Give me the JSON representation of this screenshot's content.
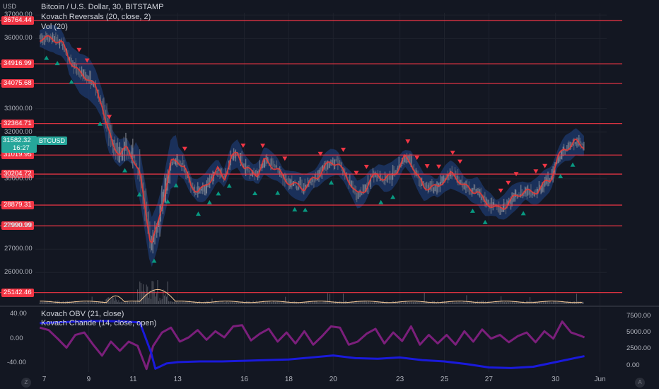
{
  "legend": {
    "symbol": "Bitcoin / U.S. Dollar, 30, BITSTAMP",
    "ind1": "Kovach Reversals (20, close, 2)",
    "ind2": "Vol (20)",
    "ind3": "Kovach OBV (21, close)",
    "ind4": "Kovach Chande (14, close, open)"
  },
  "axis_currency": "USD",
  "last_price": {
    "value": "31582.32",
    "countdown": "16:27",
    "symbol": "BTCUSD"
  },
  "corner_left": "Z",
  "corner_right": "A",
  "colors": {
    "background": "#131722",
    "level_line": "#f23645",
    "badge": "#f23645",
    "price_badge": "#26a69a",
    "trend_line": "#e53935",
    "band": "#1e3a6e",
    "arrow_up": "#089981",
    "arrow_down": "#f23645",
    "volume": "#8a8d96",
    "volume_ma": "#f5c896",
    "obv": "#1a1adb",
    "chande": "#7b1f7b",
    "grid": "#1e222d"
  },
  "chart_data": [
    {
      "type": "line",
      "name": "price",
      "ylim": [
        24800,
        37100
      ],
      "y_ticks": [
        {
          "value": 37000,
          "label": "37000.00"
        },
        {
          "value": 36000,
          "label": "36000.00"
        },
        {
          "value": 33000,
          "label": "33000.00"
        },
        {
          "value": 32000,
          "label": "32000.00"
        },
        {
          "value": 30000,
          "label": "30000.00"
        },
        {
          "value": 28000,
          "label": "28000.00"
        },
        {
          "value": 27000,
          "label": "27000.00"
        },
        {
          "value": 26000,
          "label": "26000.00"
        }
      ],
      "x_ticks": [
        {
          "x": 7,
          "label": "7"
        },
        {
          "x": 9,
          "label": "9"
        },
        {
          "x": 11,
          "label": "11"
        },
        {
          "x": 13,
          "label": "13"
        },
        {
          "x": 16,
          "label": "16"
        },
        {
          "x": 18,
          "label": "18"
        },
        {
          "x": 20,
          "label": "20"
        },
        {
          "x": 23,
          "label": "23"
        },
        {
          "x": 25,
          "label": "25"
        },
        {
          "x": 27,
          "label": "27"
        },
        {
          "x": 30,
          "label": "30"
        },
        {
          "x": 32,
          "label": "Jun"
        }
      ],
      "levels": [
        {
          "value": 36764.44,
          "label": "36764.44"
        },
        {
          "value": 34916.99,
          "label": "34916.99"
        },
        {
          "value": 34075.68,
          "label": "34075.68"
        },
        {
          "value": 32364.71,
          "label": "32364.71"
        },
        {
          "value": 31019.95,
          "label": "31019.95"
        },
        {
          "value": 30204.72,
          "label": "30204.72"
        },
        {
          "value": 28879.31,
          "label": "28879.31"
        },
        {
          "value": 27990.99,
          "label": "27990.99"
        },
        {
          "value": 25142.46,
          "label": "25142.46"
        }
      ],
      "series": [
        {
          "x": [
            6.8,
            7.4,
            7.8,
            8.2,
            8.6,
            9.0,
            9.3,
            9.6,
            9.8,
            10.1,
            10.4,
            10.7,
            11.0,
            11.3,
            11.6,
            11.8,
            12.1,
            12.4,
            12.7,
            13.0,
            13.3,
            13.6,
            13.9,
            14.2,
            14.5,
            14.8,
            15.1,
            15.4,
            15.7,
            16.0,
            16.3,
            16.6,
            16.9,
            17.2,
            17.5,
            17.8,
            18.1,
            18.4,
            18.7,
            19.0,
            19.3,
            19.6,
            19.9,
            20.2,
            20.5,
            20.8,
            21.1,
            21.4,
            21.7,
            22.0,
            22.3,
            22.6,
            22.9,
            23.2,
            23.5,
            23.8,
            24.1,
            24.4,
            24.7,
            25.0,
            25.3,
            25.6,
            25.9,
            26.2,
            26.5,
            26.8,
            27.1,
            27.4,
            27.7,
            28.0,
            28.3,
            28.6,
            28.9,
            29.2,
            29.5,
            29.8,
            30.1,
            30.4,
            30.7,
            30.9,
            31.1,
            31.3
          ],
          "values": [
            36000,
            36000,
            35800,
            35000,
            34500,
            34300,
            33900,
            33200,
            32300,
            31400,
            31100,
            31300,
            30900,
            30200,
            28400,
            27200,
            28000,
            29300,
            30700,
            30800,
            30500,
            29700,
            29500,
            29600,
            30000,
            30400,
            30000,
            30900,
            31100,
            30500,
            30300,
            30200,
            30800,
            30600,
            30400,
            30000,
            29800,
            29700,
            29600,
            29900,
            30100,
            30500,
            30700,
            30700,
            30200,
            29800,
            29300,
            29500,
            30000,
            30200,
            30000,
            30100,
            30400,
            30900,
            30700,
            30100,
            29600,
            29700,
            29600,
            30000,
            30200,
            30000,
            29700,
            29500,
            29500,
            29000,
            28900,
            28700,
            28800,
            29100,
            29300,
            29500,
            29400,
            29500,
            29800,
            30000,
            30900,
            31300,
            31400,
            31600,
            31500,
            31400
          ]
        }
      ]
    },
    {
      "type": "bar",
      "name": "volume",
      "ylim": [
        0,
        2.2
      ]
    },
    {
      "type": "line",
      "name": "oscillators",
      "y_ticks_left": [
        {
          "value": 40,
          "label": "40.00"
        },
        {
          "value": 0,
          "label": "0.00"
        },
        {
          "value": -40,
          "label": "-40.00"
        }
      ],
      "ylim_left": [
        -55,
        45
      ],
      "y_ticks_right": [
        {
          "value": 7500,
          "label": "7500.00"
        },
        {
          "value": 5000,
          "label": "5000.00"
        },
        {
          "value": 2500,
          "label": "2500.00"
        },
        {
          "value": 0,
          "label": "0.00"
        }
      ],
      "ylim_right": [
        -1000,
        8200
      ],
      "series": [
        {
          "name": "Kovach OBV",
          "axis": "right",
          "x": [
            6.8,
            7.5,
            8.2,
            9.0,
            9.8,
            10.6,
            11.3,
            11.8,
            12.0,
            12.5,
            13.0,
            14.0,
            15.0,
            16.0,
            17.0,
            18.0,
            19.0,
            20.0,
            21.0,
            22.0,
            23.0,
            24.0,
            25.0,
            26.0,
            27.0,
            28.0,
            29.0,
            30.0,
            31.0,
            31.3
          ],
          "values": [
            6400,
            6500,
            6600,
            6700,
            6700,
            6650,
            6500,
            2000,
            -500,
            300,
            500,
            600,
            600,
            700,
            800,
            900,
            1200,
            1500,
            1100,
            1000,
            1200,
            800,
            600,
            200,
            -300,
            -400,
            -200,
            500,
            1200,
            1400
          ]
        },
        {
          "name": "Kovach Chande",
          "axis": "left",
          "x": [
            6.8,
            7.2,
            7.6,
            8.0,
            8.4,
            8.8,
            9.2,
            9.6,
            10.0,
            10.4,
            10.8,
            11.2,
            11.6,
            11.9,
            12.3,
            12.7,
            13.1,
            13.5,
            13.9,
            14.3,
            14.7,
            15.1,
            15.5,
            15.9,
            16.3,
            16.7,
            17.1,
            17.5,
            17.9,
            18.3,
            18.7,
            19.1,
            19.5,
            19.9,
            20.3,
            20.7,
            21.1,
            21.5,
            21.9,
            22.3,
            22.7,
            23.1,
            23.5,
            23.9,
            24.3,
            24.7,
            25.1,
            25.5,
            25.9,
            26.3,
            26.7,
            27.1,
            27.5,
            27.9,
            28.3,
            28.7,
            29.1,
            29.5,
            29.9,
            30.3,
            30.7,
            31.1,
            31.3
          ],
          "values": [
            18,
            14,
            0,
            -15,
            6,
            10,
            -10,
            -28,
            -5,
            -20,
            -5,
            -12,
            -50,
            -12,
            10,
            18,
            -5,
            2,
            14,
            -2,
            12,
            2,
            20,
            22,
            -3,
            8,
            16,
            -5,
            10,
            -8,
            12,
            -10,
            4,
            20,
            18,
            -10,
            -5,
            8,
            16,
            -8,
            10,
            -4,
            20,
            -10,
            6,
            -8,
            6,
            -10,
            12,
            -5,
            15,
            0,
            6,
            -6,
            4,
            10,
            -6,
            12,
            0,
            28,
            10,
            5,
            2
          ]
        }
      ]
    }
  ]
}
